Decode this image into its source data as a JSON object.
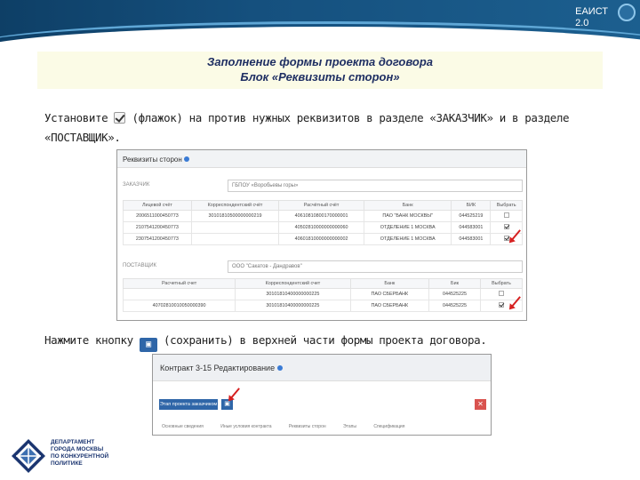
{
  "banner": {
    "brand_line1": "ЕАИСТ",
    "brand_line2": "2.0"
  },
  "slide": {
    "title_line1": "Заполнение формы проекта договора",
    "title_line2": "Блок «Реквизиты сторон»",
    "instruction1_pre": "Установите ",
    "instruction1_post": " (флажок) на против нужных реквизитов в разделе «ЗАКАЗЧИК» и в разделе «ПОСТАВЩИК».",
    "instruction2_pre": "Нажмите кнопку ",
    "instruction2_post": " (сохранить) в верхней части формы проекта договора."
  },
  "screenshot1": {
    "panel_title": "Реквизиты сторон",
    "customer": {
      "label": "ЗАКАЗЧИК",
      "value": "ГБПОУ «Воробьевы горы»",
      "headers": [
        "Лицевой счёт",
        "Корреспондентский счёт",
        "Расчётный счёт",
        "Банк",
        "БИК",
        "Выбрать"
      ],
      "rows": [
        {
          "cells": [
            "2006511000450773",
            "30101810500000000219",
            "40610810800170000001",
            "ПАО \"БАНК МОСКВЫ\"",
            "044525219"
          ],
          "checked": false
        },
        {
          "cells": [
            "2107541200450773",
            "",
            "40502810000000000060",
            "ОТДЕЛЕНИЕ 1 МОСКВА",
            "044583001"
          ],
          "checked": true
        },
        {
          "cells": [
            "2307541200450773",
            "",
            "40601810000000000002",
            "ОТДЕЛЕНИЕ 1 МОСКВА",
            "044583001"
          ],
          "checked": true
        }
      ]
    },
    "supplier": {
      "label": "ПОСТАВЩИК",
      "value": "ООО \"Сакатов - Дандравов\"",
      "headers": [
        "Расчетный счет",
        "Корреспондентский счет",
        "Банк",
        "Бик",
        "Выбрать"
      ],
      "rows": [
        {
          "cells": [
            "",
            "30101810400000000225",
            "ПАО СБЕРБАНК",
            "044525225"
          ],
          "checked": false
        },
        {
          "cells": [
            "40702810010050000390",
            "30101810400000000225",
            "ПАО СБЕРБАНК",
            "044525225"
          ],
          "checked": true
        }
      ]
    }
  },
  "screenshot2": {
    "title": "Контракт 3-15 Редактирование",
    "action_button": "Этап проекта заказчиком",
    "save_glyph": "▣",
    "close_glyph": "✕",
    "tabs": [
      "Основные сведения",
      "Иные условия контракта",
      "Реквизиты сторон",
      "Этапы",
      "Спецификация"
    ]
  },
  "logo": {
    "line1": "Департамент",
    "line2": "города Москвы",
    "line3": "по конкурентной",
    "line4": "политике"
  },
  "colors": {
    "accent": "#2f66a8",
    "banner": "#15507e",
    "title": "#1f2f63",
    "arrow": "#d62020"
  }
}
